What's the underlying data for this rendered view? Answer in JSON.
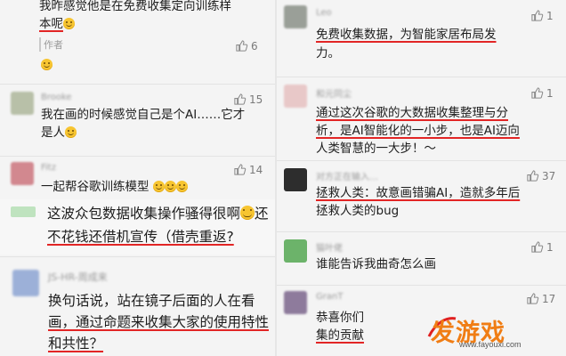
{
  "left": {
    "c1": {
      "line1": "我昨感觉他是在免费收集定向训练样",
      "line2": "本呢",
      "author_tag": "作者",
      "likes": "6"
    },
    "c2": {
      "user": "Brooke",
      "line1": "我在画的时候感觉自己是个AI……它才",
      "line2": "是人",
      "likes": "15"
    },
    "c3": {
      "user": "Fitz",
      "line1": "一起帮谷歌训练模型",
      "likes": "14"
    },
    "c4": {
      "line1": "这波众包数据收集操作骚得很啊",
      "line1b": "还",
      "line2": "不花钱还借机宣传（借壳重返?"
    },
    "c5": {
      "user": "JS-HR-周成来",
      "line1": "换句话说，站在镜子后面的人在看",
      "line2": "画，通过命题来收集大家的使用特性",
      "line3": "和共性？"
    }
  },
  "right": {
    "r1": {
      "user": "Leo",
      "line1": "免费收集数据，为智能家居布局发",
      "line2": "力。",
      "likes": "1"
    },
    "r2": {
      "user": "和元同尘",
      "line1": "通过这次谷歌的大数据收集整理与分",
      "line2": "析，是AI智能化的一小步，也是AI迈向",
      "line3": "人类智慧的一大步！～",
      "likes": "1"
    },
    "r3": {
      "user": "对方正在输入…",
      "line1": "拯救人类：故意画错骗AI，造就多年后",
      "line2": "拯救人类的bug",
      "likes": "37"
    },
    "r4": {
      "user": "猫叶佬",
      "line1": "谁能告诉我曲奇怎么画",
      "likes": "1"
    },
    "r5": {
      "user": "GranT",
      "line1": "恭喜你们",
      "line2": "集的贡献",
      "likes": "17"
    }
  },
  "watermark": {
    "brand": "发游戏",
    "url": "www.fayouxi.com"
  },
  "icons": {
    "like": "thumbs-up-icon",
    "emoji": "laughing-emoji-icon"
  },
  "colors": {
    "underline": "#e22525",
    "background": "#f4f4f4",
    "brand_orange": "#f07d14",
    "brand_red": "#e02020"
  }
}
